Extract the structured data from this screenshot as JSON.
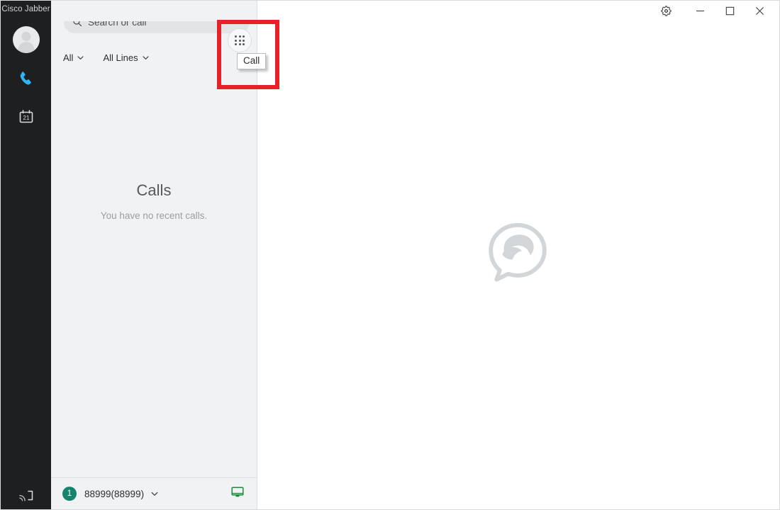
{
  "window": {
    "app_name": "Cisco Jabber",
    "controls": [
      {
        "name": "settings",
        "label": "Settings",
        "icon": "gear-icon"
      },
      {
        "name": "minimize",
        "label": "Minimize",
        "icon": "minimize-icon"
      },
      {
        "name": "maximize",
        "label": "Maximize",
        "icon": "maximize-icon"
      },
      {
        "name": "close",
        "label": "Close",
        "icon": "close-icon"
      }
    ]
  },
  "rail": {
    "title": "Cisco Jabber",
    "items": [
      {
        "name": "avatar",
        "label": "Profile avatar",
        "icon": "avatar-icon"
      },
      {
        "name": "calls",
        "label": "Calls",
        "icon": "phone-icon",
        "active": true,
        "color": "#2fb5ef"
      },
      {
        "name": "meetings",
        "label": "Meetings",
        "icon": "calendar-icon",
        "badge_day": "21"
      }
    ],
    "bottom": {
      "name": "share-screen",
      "label": "Share screen",
      "icon": "screen-cast-icon"
    }
  },
  "search": {
    "placeholder": "Search or call",
    "value": "",
    "icon": "search-icon"
  },
  "call_button": {
    "label": "Call",
    "icon": "dialpad-icon",
    "tooltip": "Call",
    "highlighted": true,
    "highlight_color": "#e8202a"
  },
  "filters": [
    {
      "name": "all",
      "label": "All",
      "icon": "chevron-down-icon"
    },
    {
      "name": "all-lines",
      "label": "All Lines",
      "icon": "chevron-down-icon"
    }
  ],
  "empty_state": {
    "title": "Calls",
    "subtitle": "You have no recent calls."
  },
  "status_bar": {
    "badge_count": "1",
    "badge_color": "#16836c",
    "line_label": "88999(88999)",
    "caret_icon": "chevron-down-icon",
    "device_icon": "monitor-icon",
    "device_color": "#1f8b3d"
  },
  "content": {
    "watermark_icon": "jabber-logo-watermark"
  }
}
